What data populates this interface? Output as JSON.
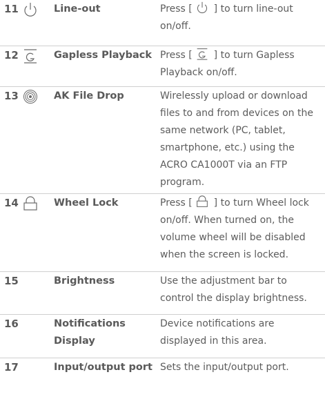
{
  "rows": [
    {
      "number": "11",
      "icon": "power-icon",
      "name": "Line-out",
      "description_parts": [
        "Press [ ",
        "power-icon",
        " ] to turn line-out on/off."
      ]
    },
    {
      "number": "12",
      "icon": "gapless-icon",
      "name": "Gapless Playback",
      "description_parts": [
        "Press [ ",
        "gapless-icon",
        " ] to turn Gapless Playback on/off."
      ]
    },
    {
      "number": "13",
      "icon": "wireless-icon",
      "name": "AK File Drop",
      "description": "Wirelessly upload or download files to and from devices on the same network (PC, tablet, smartphone, etc.) using the ACRO CA1000T via an FTP program."
    },
    {
      "number": "14",
      "icon": "lock-icon",
      "name": "Wheel Lock",
      "description_parts": [
        "Press [ ",
        "lock-icon",
        " ] to turn Wheel lock on/off. When turned on, the volume wheel will be disabled when the screen is locked."
      ]
    },
    {
      "number": "15",
      "name": "Brightness",
      "description": "Use the adjustment bar to control the display brightness."
    },
    {
      "number": "16",
      "name": "Notifications Display",
      "description": "Device notifications are displayed in this area."
    },
    {
      "number": "17",
      "name": "Input/output port",
      "description": "Sets the input/output port."
    }
  ],
  "colors": {
    "text": "#565656",
    "divider": "#cfcfcf"
  }
}
